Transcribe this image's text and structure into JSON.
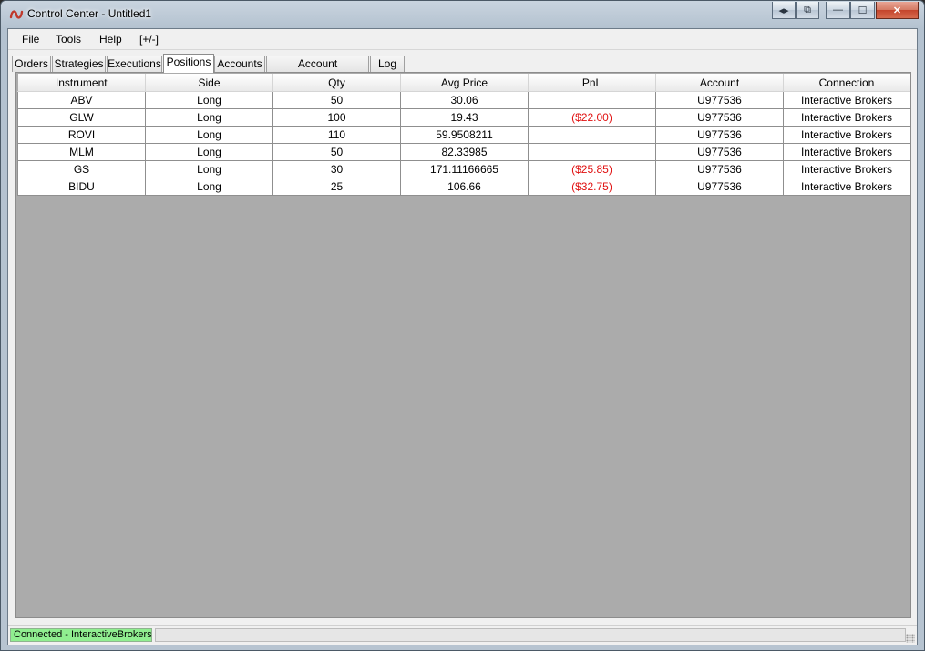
{
  "window": {
    "title": "Control Center - Untitled1",
    "caption_buttons": [
      "◂▸",
      "⧉",
      "—",
      "☐",
      "✕"
    ]
  },
  "menu": [
    {
      "label": "File"
    },
    {
      "label": "Tools"
    },
    {
      "label": "Help"
    },
    {
      "label": "[+/-]"
    }
  ],
  "tabs": [
    {
      "label": "Orders",
      "active": false
    },
    {
      "label": "Strategies",
      "active": false
    },
    {
      "label": "Executions",
      "active": false
    },
    {
      "label": "Positions",
      "active": true
    },
    {
      "label": "Accounts",
      "active": false
    },
    {
      "label": "Account Performance",
      "active": false
    },
    {
      "label": "Log",
      "active": false
    }
  ],
  "positions": {
    "columns": [
      "Instrument",
      "Side",
      "Qty",
      "Avg Price",
      "PnL",
      "Account",
      "Connection"
    ],
    "rows": [
      {
        "instrument": "ABV",
        "side": "Long",
        "qty": "50",
        "avg_price": "30.06",
        "pnl": "",
        "account": "U977536",
        "connection": "Interactive Brokers"
      },
      {
        "instrument": "GLW",
        "side": "Long",
        "qty": "100",
        "avg_price": "19.43",
        "pnl": "($22.00)",
        "account": "U977536",
        "connection": "Interactive Brokers"
      },
      {
        "instrument": "ROVI",
        "side": "Long",
        "qty": "110",
        "avg_price": "59.9508211",
        "pnl": "",
        "account": "U977536",
        "connection": "Interactive Brokers"
      },
      {
        "instrument": "MLM",
        "side": "Long",
        "qty": "50",
        "avg_price": "82.33985",
        "pnl": "",
        "account": "U977536",
        "connection": "Interactive Brokers"
      },
      {
        "instrument": "GS",
        "side": "Long",
        "qty": "30",
        "avg_price": "171.11166665",
        "pnl": "($25.85)",
        "account": "U977536",
        "connection": "Interactive Brokers"
      },
      {
        "instrument": "BIDU",
        "side": "Long",
        "qty": "25",
        "avg_price": "106.66",
        "pnl": "($32.75)",
        "account": "U977536",
        "connection": "Interactive Brokers"
      }
    ]
  },
  "status": {
    "connection_text": "Connected - InteractiveBrokers",
    "connection_color": "#90ee90"
  },
  "colors": {
    "negative_pnl": "#e01010",
    "panel_background": "#ababab"
  }
}
